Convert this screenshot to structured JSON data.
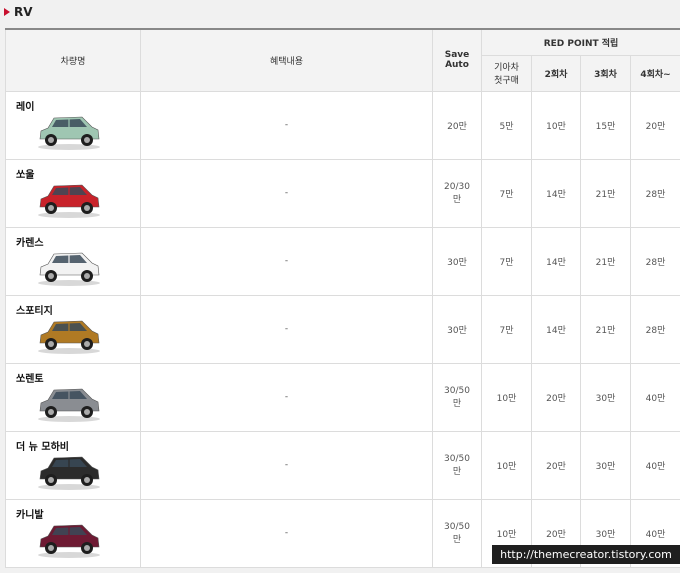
{
  "section": {
    "title": "RV"
  },
  "headers": {
    "car_name": "차량명",
    "benefit": "혜택내용",
    "save_auto_line1": "Save",
    "save_auto_line2": "Auto",
    "red_point": "RED POINT 적립",
    "first_line1": "기아차",
    "first_line2": "첫구매",
    "second": "2회차",
    "third": "3회차",
    "fourth": "4회차~"
  },
  "rows": [
    {
      "name": "레이",
      "benefit": "-",
      "save_auto": "20만",
      "first": "5만",
      "second": "10만",
      "third": "15만",
      "fourth": "20만",
      "body_color": "#9fc6b2",
      "icon": "ray-car-image"
    },
    {
      "name": "쏘울",
      "benefit": "-",
      "save_auto": "20/30\n만",
      "first": "7만",
      "second": "14만",
      "third": "21만",
      "fourth": "28만",
      "body_color": "#c8222a",
      "icon": "soul-car-image"
    },
    {
      "name": "카렌스",
      "benefit": "-",
      "save_auto": "30만",
      "first": "7만",
      "second": "14만",
      "third": "21만",
      "fourth": "28만",
      "body_color": "#f2f2f2",
      "icon": "carens-car-image"
    },
    {
      "name": "스포티지",
      "benefit": "-",
      "save_auto": "30만",
      "first": "7만",
      "second": "14만",
      "third": "21만",
      "fourth": "28만",
      "body_color": "#b07a24",
      "icon": "sportage-car-image"
    },
    {
      "name": "쏘렌토",
      "benefit": "-",
      "save_auto": "30/50\n만",
      "first": "10만",
      "second": "20만",
      "third": "30만",
      "fourth": "40만",
      "body_color": "#8a8d92",
      "icon": "sorento-car-image"
    },
    {
      "name": "더 뉴 모하비",
      "benefit": "-",
      "save_auto": "30/50\n만",
      "first": "10만",
      "second": "20만",
      "third": "30만",
      "fourth": "40만",
      "body_color": "#2b2b2b",
      "icon": "mohave-car-image"
    },
    {
      "name": "카니발",
      "benefit": "-",
      "save_auto": "30/50\n만",
      "first": "10만",
      "second": "20만",
      "third": "30만",
      "fourth": "40만",
      "body_color": "#6e1a33",
      "icon": "carnival-car-image"
    }
  ],
  "watermark": "http://themecreator.tistory.com",
  "colors": {
    "accent": "#c8102e",
    "header_bg": "#f3f3f3",
    "border": "#dcdcdc"
  }
}
